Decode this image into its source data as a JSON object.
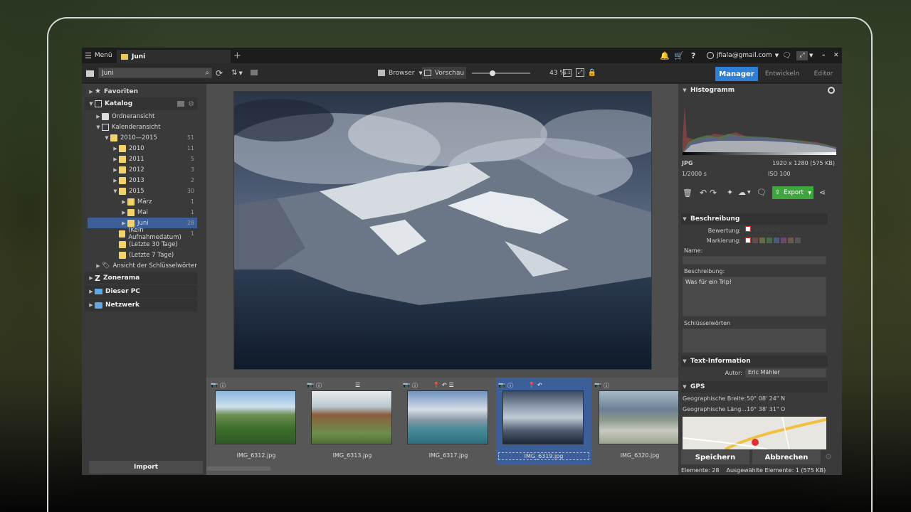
{
  "titlebar": {
    "menu_label": "Menü",
    "tab_label": "Juni",
    "add_tab": "+",
    "account": "jfiala@gmail.com",
    "minimize": "–",
    "close": "✕"
  },
  "toolbar": {
    "search_value": "Juni",
    "browser_label": "Browser",
    "preview_label": "Vorschau",
    "zoom_value": "43 %",
    "zoom_fraction": 0.35,
    "modes": [
      "Manager",
      "Entwickeln",
      "Editor"
    ]
  },
  "left": {
    "favorites": "Favoriten",
    "catalog": "Katalog",
    "folder_view": "Ordneransicht",
    "calendar_view": "Kalenderansicht",
    "years": [
      {
        "label": "2010—2015",
        "count": "51"
      },
      {
        "label": "2010",
        "count": "11"
      },
      {
        "label": "2011",
        "count": "5"
      },
      {
        "label": "2012",
        "count": "3"
      },
      {
        "label": "2013",
        "count": "2"
      },
      {
        "label": "2015",
        "count": "30"
      },
      {
        "label": "März",
        "count": "1"
      },
      {
        "label": "Mai",
        "count": "1"
      },
      {
        "label": "Juni",
        "count": "28"
      },
      {
        "label": "(Kein Aufnahmedatum)",
        "count": "1"
      },
      {
        "label": "(Letzte 30 Tage)",
        "count": ""
      },
      {
        "label": "(Letzte 7 Tage)",
        "count": ""
      }
    ],
    "keywords": "Ansicht der Schlüsselwörter",
    "zonerama": "Zonerama",
    "this_pc": "Dieser PC",
    "network": "Netzwerk",
    "import": "Import"
  },
  "film": [
    {
      "name": "IMG_6312.jpg"
    },
    {
      "name": "IMG_6313.jpg"
    },
    {
      "name": "IMG_6317.jpg"
    },
    {
      "name": "IMG_6319.jpg"
    },
    {
      "name": "IMG_6320.jpg"
    }
  ],
  "right": {
    "histogram_title": "Histogramm",
    "format": "JPG",
    "dimensions": "1920 x 1280 (575 KB)",
    "shutter": "1/2000 s",
    "iso": "ISO 100",
    "export": "Export",
    "description_title": "Beschreibung",
    "rating_label": "Bewertung:",
    "marking_label": "Markierung:",
    "name_label": "Name:",
    "desc_label": "Beschreibung:",
    "desc_value": "Was für ein Trip!",
    "keywords_label": "Schlüsselwörten",
    "textinfo_title": "Text-Information",
    "author_label": "Autor:",
    "author_value": "Eric Mähler",
    "gps_title": "GPS",
    "lat_label": "Geographische Breite:",
    "lat_value": "50° 08' 24\" N",
    "lon_label": "Geographische Läng...",
    "lon_value": "10° 38' 31\" O",
    "save": "Speichern",
    "cancel": "Abbrechen",
    "status_elements": "Elemente: 28",
    "status_selected": "Ausgewählte Elemente: 1 (575 KB)"
  },
  "colors": {
    "accent": "#2f7fd6",
    "export_green": "#3fa63f",
    "selection": "#3c5f9a"
  }
}
